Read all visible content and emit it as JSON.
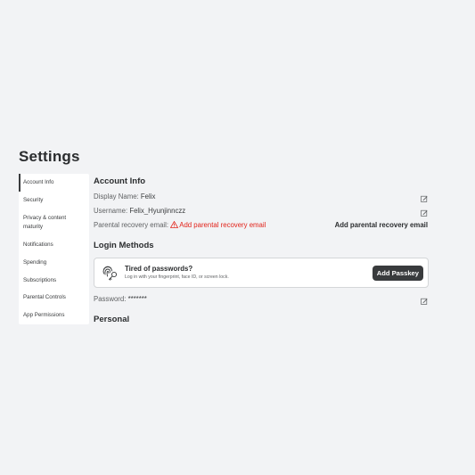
{
  "page": {
    "title": "Settings"
  },
  "sidebar": {
    "items": [
      {
        "label": "Account Info",
        "active": true
      },
      {
        "label": "Security"
      },
      {
        "label": "Privacy & content"
      },
      {
        "label": "maturity"
      },
      {
        "label": "Notifications"
      },
      {
        "label": "Spending"
      },
      {
        "label": "Subscriptions"
      },
      {
        "label": "Parental Controls"
      },
      {
        "label": "App Permissions"
      }
    ]
  },
  "account_info": {
    "title": "Account Info",
    "display_name_label": "Display Name:",
    "display_name_value": "Felix",
    "username_label": "Username:",
    "username_value": "Felix_Hyunjinnczz",
    "recovery_label": "Parental recovery email:",
    "recovery_warning": "Add parental recovery email",
    "recovery_action": "Add parental recovery email"
  },
  "login_methods": {
    "title": "Login Methods",
    "passkey_title": "Tired of passwords?",
    "passkey_subtitle": "Log in with your fingerprint, face ID, or screen lock.",
    "passkey_button": "Add Passkey",
    "password_label": "Password:",
    "password_value": "*******"
  },
  "personal": {
    "title": "Personal"
  },
  "colors": {
    "background": "#f2f3f5",
    "warning": "#e2231a",
    "button_dark": "#393b3d"
  }
}
